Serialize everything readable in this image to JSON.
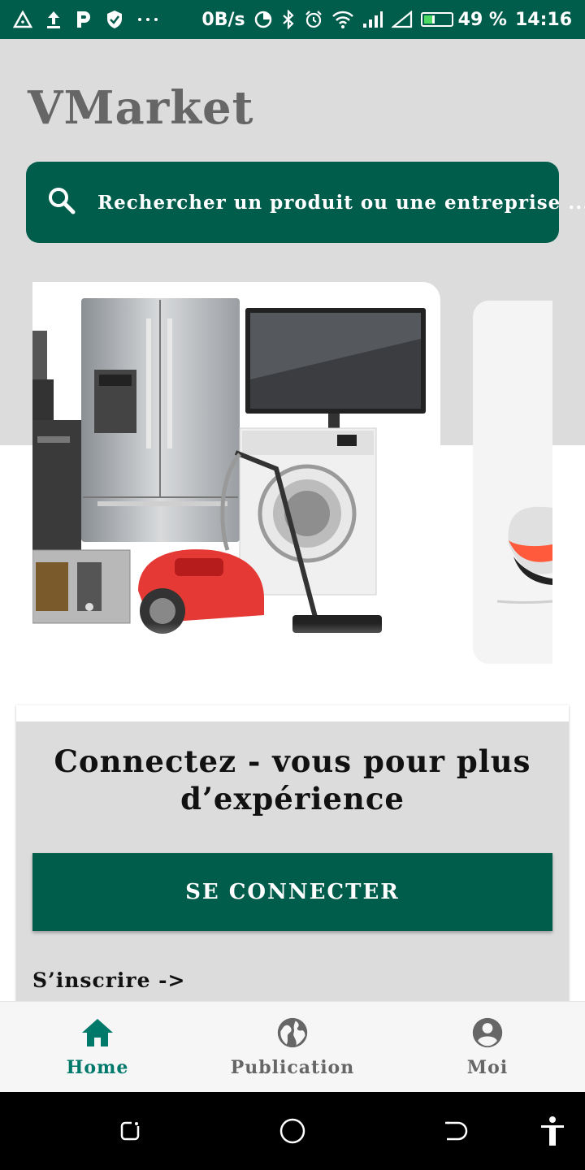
{
  "status_bar": {
    "speed": "0B/s",
    "battery": "49 %",
    "battery_level": 0.49,
    "time": "14:16",
    "left_icons": [
      "warning-triangle-icon",
      "upload-icon",
      "parking-icon",
      "shield-icon",
      "more-dots-icon"
    ],
    "right_icons": [
      "data-saver-icon",
      "bluetooth-icon",
      "alarm-icon",
      "wifi-icon",
      "signal-icon",
      "signal-empty-icon",
      "battery-icon"
    ]
  },
  "header": {
    "app_title": "VMarket"
  },
  "search": {
    "placeholder": "Rechercher un produit ou une entreprise ..."
  },
  "banner": {
    "slides": [
      {
        "icon": "home-appliances-image"
      },
      {
        "icon": "sneaker-image"
      }
    ]
  },
  "login_card": {
    "title": "Connectez - vous pour plus d’expérience",
    "connect_button": "SE CONNECTER",
    "signup_link": "S’inscrire   ->"
  },
  "bottom_nav": {
    "items": [
      {
        "label": "Home",
        "icon": "home-icon",
        "active": true
      },
      {
        "label": "Publication",
        "icon": "globe-icon",
        "active": false
      },
      {
        "label": "Moi",
        "icon": "account-circle-icon",
        "active": false
      }
    ]
  },
  "colors": {
    "primary": "#005c4b",
    "background_gray": "#dcdcdc",
    "title_gray": "#666666",
    "active_nav": "#00796b",
    "inactive_nav": "#666666"
  }
}
